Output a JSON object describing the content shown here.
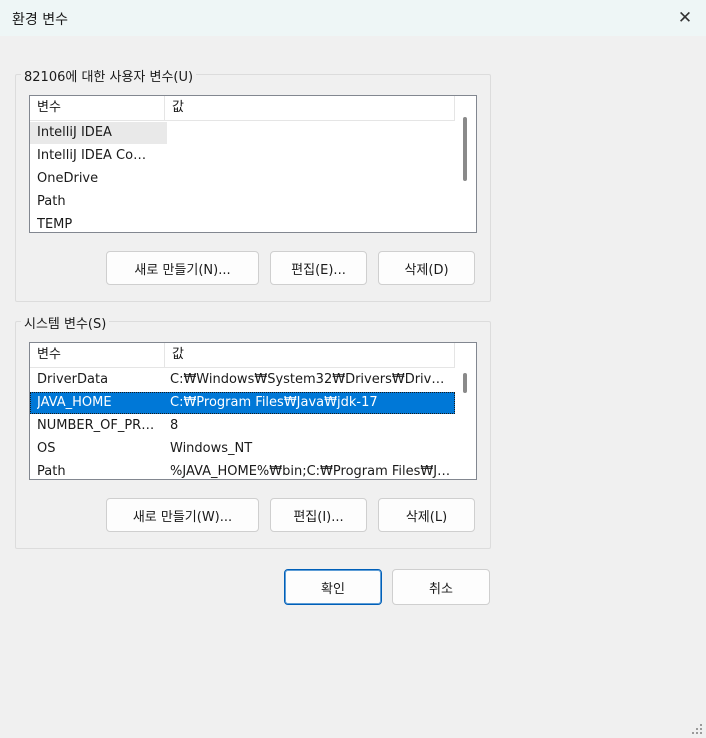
{
  "window": {
    "title": "환경 변수",
    "close_glyph": "✕"
  },
  "user_vars": {
    "label": "82106에 대한 사용자 변수(U)",
    "col_name": "변수",
    "col_value": "값",
    "rows": [
      {
        "name": "IntelliJ IDEA",
        "value": ""
      },
      {
        "name": "IntelliJ IDEA Com...",
        "value": ""
      },
      {
        "name": "OneDrive",
        "value": ""
      },
      {
        "name": "Path",
        "value": ""
      },
      {
        "name": "TEMP",
        "value": ""
      }
    ],
    "buttons": {
      "new": "새로 만들기(N)...",
      "edit": "편집(E)...",
      "delete": "삭제(D)"
    }
  },
  "system_vars": {
    "label": "시스템 변수(S)",
    "col_name": "변수",
    "col_value": "값",
    "rows": [
      {
        "name": "DriverData",
        "value": "C:₩Windows₩System32₩Drivers₩DriverDa..."
      },
      {
        "name": "JAVA_HOME",
        "value": "C:₩Program Files₩Java₩jdk-17"
      },
      {
        "name": "NUMBER_OF_PRO...",
        "value": "8"
      },
      {
        "name": "OS",
        "value": "Windows_NT"
      },
      {
        "name": "Path",
        "value": "%JAVA_HOME%₩bin;C:₩Program Files₩Ja..."
      }
    ],
    "buttons": {
      "new": "새로 만들기(W)...",
      "edit": "편집(I)...",
      "delete": "삭제(L)"
    }
  },
  "footer": {
    "ok": "확인",
    "cancel": "취소"
  },
  "colors": {
    "selection": "#0078d7",
    "primary_border": "#005fb8",
    "titlebar": "#eef6f6"
  },
  "icons": {
    "close": "close-icon",
    "resize": "resize-grip-icon"
  }
}
